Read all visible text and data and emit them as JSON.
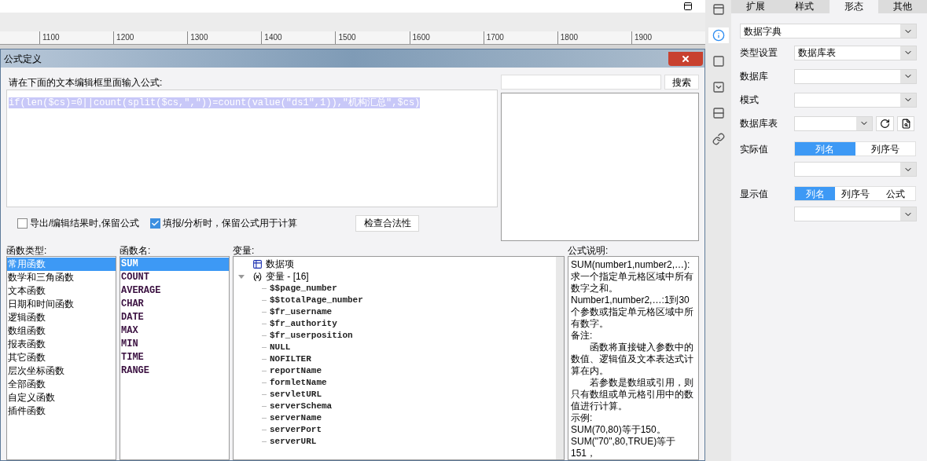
{
  "ruler": {
    "ticks": [
      "1100",
      "1200",
      "1300",
      "1400",
      "1500",
      "1600",
      "1700",
      "1800",
      "1900"
    ]
  },
  "dialog": {
    "title": "公式定义",
    "prompt": "请在下面的文本编辑框里面输入公式:",
    "formula": "if(len($cs)=0||count(split($cs,\",\"))=count(value(\"ds1\",1)),\"机构汇总\",$cs)",
    "formula_selected": true,
    "search_button": "搜索",
    "options": [
      {
        "label": "导出/编辑结果时,保留公式",
        "checked": false
      },
      {
        "label": "填报/分析时，保留公式用于计算",
        "checked": true
      }
    ],
    "check_button": "检查合法性",
    "function_types": {
      "heading": "函数类型:",
      "items": [
        {
          "label": "常用函数",
          "selected": true
        },
        {
          "label": "数学和三角函数",
          "selected": false
        },
        {
          "label": "文本函数",
          "selected": false
        },
        {
          "label": "日期和时间函数",
          "selected": false
        },
        {
          "label": "逻辑函数",
          "selected": false
        },
        {
          "label": "数组函数",
          "selected": false
        },
        {
          "label": "报表函数",
          "selected": false
        },
        {
          "label": "其它函数",
          "selected": false
        },
        {
          "label": "层次坐标函数",
          "selected": false
        },
        {
          "label": "全部函数",
          "selected": false
        },
        {
          "label": "自定义函数",
          "selected": false
        },
        {
          "label": "插件函数",
          "selected": false
        }
      ]
    },
    "function_names": {
      "heading": "函数名:",
      "items": [
        {
          "label": "SUM",
          "selected": true
        },
        {
          "label": "COUNT",
          "selected": false
        },
        {
          "label": "AVERAGE",
          "selected": false
        },
        {
          "label": "CHAR",
          "selected": false
        },
        {
          "label": "DATE",
          "selected": false
        },
        {
          "label": "MAX",
          "selected": false
        },
        {
          "label": "MIN",
          "selected": false
        },
        {
          "label": "TIME",
          "selected": false
        },
        {
          "label": "RANGE",
          "selected": false
        }
      ]
    },
    "variables": {
      "heading": "变量:",
      "tree": [
        {
          "label": "数据项",
          "kind": "data"
        },
        {
          "label": "变量 - [16]",
          "kind": "variables",
          "expanded": true,
          "children": [
            {
              "label": "$$page_number"
            },
            {
              "label": "$$totalPage_number"
            },
            {
              "label": "$fr_username"
            },
            {
              "label": "$fr_authority"
            },
            {
              "label": "$fr_userposition"
            },
            {
              "label": "NULL"
            },
            {
              "label": "NOFILTER"
            },
            {
              "label": "reportName"
            },
            {
              "label": "formletName"
            },
            {
              "label": "servletURL"
            },
            {
              "label": "serverSchema"
            },
            {
              "label": "serverName"
            },
            {
              "label": "serverPort"
            },
            {
              "label": "serverURL"
            }
          ]
        }
      ]
    },
    "description": {
      "heading": "公式说明:",
      "paragraphs": [
        {
          "text": "SUM(number1,number2,…): 求一个指定单元格区域中所有数字之和。",
          "indented": false
        },
        {
          "text": "Number1,number2,…:1到30个参数或指定单元格区域中所有数字。",
          "indented": false
        },
        {
          "text": "备注:",
          "indented": false
        },
        {
          "text": "函数将直接键入参数中的数值、逻辑值及文本表达式计算在内。",
          "indented": true
        },
        {
          "text": "若参数是数组或引用，则只有数组或单元格引用中的数值进行计算。",
          "indented": true
        },
        {
          "text": "示例:",
          "indented": false
        },
        {
          "text": "SUM(70,80)等于150。",
          "indented": false
        },
        {
          "text": "SUM(\"70\",80,TRUE)等于151，",
          "indented": false
        }
      ]
    }
  },
  "side_strip": [
    {
      "kind": "layout",
      "selected": false
    },
    {
      "kind": "info",
      "selected": true
    },
    {
      "kind": "frame",
      "selected": false
    },
    {
      "kind": "dropdown",
      "selected": false
    },
    {
      "kind": "rows",
      "selected": false
    },
    {
      "kind": "link",
      "selected": false
    }
  ],
  "panel": {
    "tabs": [
      {
        "label": "扩展",
        "selected": false
      },
      {
        "label": "样式",
        "selected": false
      },
      {
        "label": "形态",
        "selected": true
      },
      {
        "label": "其他",
        "selected": false
      }
    ],
    "widget_type": "数据字典",
    "type_setting": {
      "label": "类型设置",
      "value": "数据库表"
    },
    "database": {
      "label": "数据库"
    },
    "schema": {
      "label": "模式"
    },
    "table": {
      "label": "数据库表"
    },
    "actual_value": {
      "label": "实际值",
      "options": [
        {
          "label": "列名",
          "selected": true
        },
        {
          "label": "列序号",
          "selected": false
        }
      ]
    },
    "display_value": {
      "label": "显示值",
      "options": [
        {
          "label": "列名",
          "selected": true
        },
        {
          "label": "列序号",
          "selected": false
        },
        {
          "label": "公式",
          "selected": false
        }
      ]
    }
  }
}
